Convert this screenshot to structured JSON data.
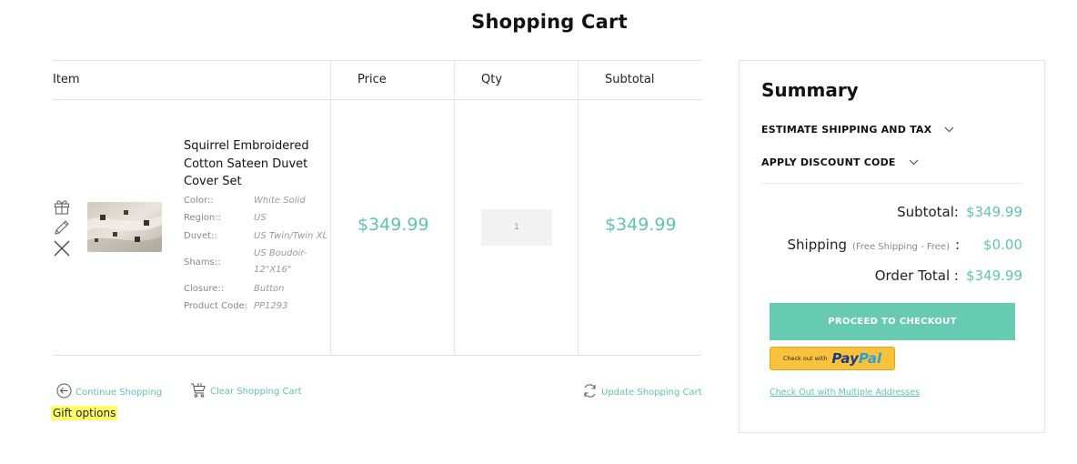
{
  "page": {
    "title": "Shopping Cart"
  },
  "table": {
    "headers": {
      "item": "Item",
      "price": "Price",
      "qty": "Qty",
      "subtotal": "Subtotal"
    }
  },
  "item": {
    "name": "Squirrel Embroidered Cotton Sateen Duvet Cover Set",
    "options": [
      {
        "label": "Color::",
        "value": "White Solid"
      },
      {
        "label": "Region::",
        "value": "US"
      },
      {
        "label": "Duvet::",
        "value": "US Twin/Twin XL"
      },
      {
        "label": "Shams::",
        "value": "US Boudoir- 12\"X16\""
      },
      {
        "label": "Closure::",
        "value": "Button"
      },
      {
        "label": "Product Code:",
        "value": "PP1293"
      }
    ],
    "price": "$349.99",
    "qty": "1",
    "subtotal": "$349.99",
    "action_icons": [
      "gift-icon",
      "pencil-icon",
      "close-icon"
    ]
  },
  "actions": {
    "continue": "Continue Shopping",
    "clear": "Clear Shopping Cart",
    "update": "Update Shopping Cart",
    "gift": "Gift options"
  },
  "summary": {
    "title": "Summary",
    "estimate": "ESTIMATE SHIPPING AND TAX",
    "discount": "APPLY DISCOUNT CODE",
    "subtotal_label": "Subtotal:",
    "subtotal_value": "$349.99",
    "shipping_label": "Shipping",
    "shipping_note": "(Free Shipping - Free)",
    "shipping_colon": ":",
    "shipping_value": "$0.00",
    "total_label": "Order Total :",
    "total_value": "$349.99",
    "checkout": "PROCEED TO CHECKOUT",
    "paypal_pre": "Check out with",
    "paypal_a": "Pay",
    "paypal_b": "Pal",
    "multi": "Check Out with Multiple Addresses"
  },
  "colors": {
    "accent": "#5fc4ad",
    "checkout_bg": "#67cbb2",
    "paypal_bg": "#f8c33a",
    "highlight": "#ffff66"
  }
}
